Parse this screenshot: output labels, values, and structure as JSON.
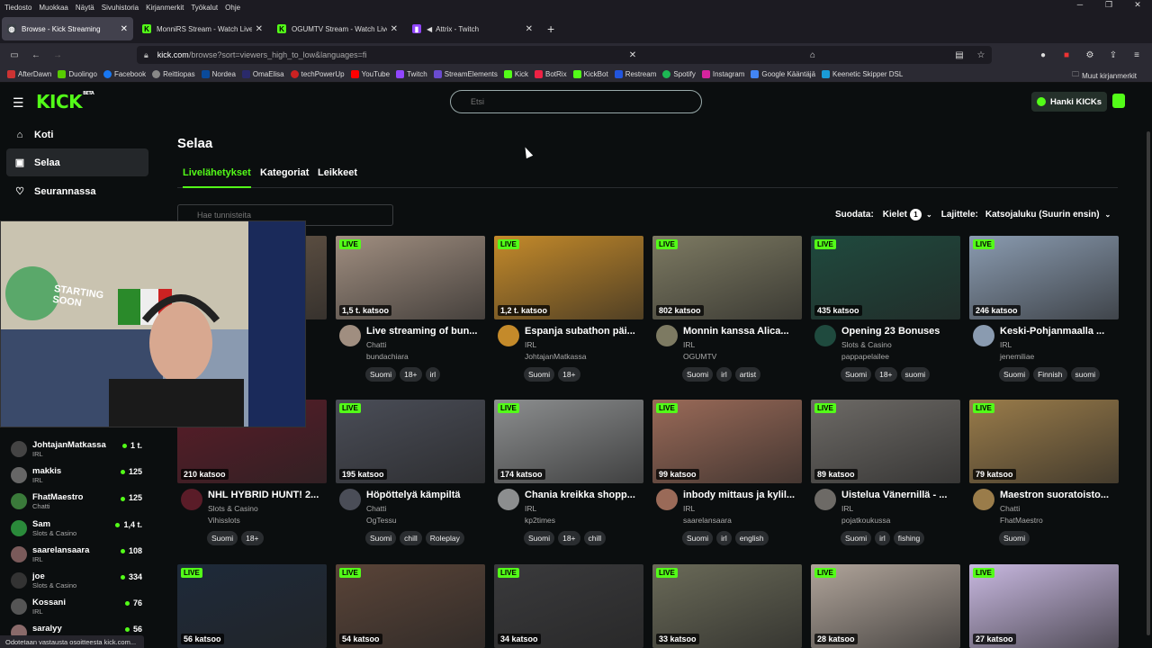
{
  "menubar": {
    "items": [
      "Tiedosto",
      "Muokkaa",
      "Näytä",
      "Sivuhistoria",
      "Kirjanmerkit",
      "Työkalut",
      "Ohje"
    ]
  },
  "tabs": [
    {
      "label": "Browse - Kick Streaming",
      "color": "#53fc18"
    },
    {
      "label": "MonniRS Stream - Watch Live o",
      "color": "#53fc18"
    },
    {
      "label": "OGUMTV Stream - Watch Live o",
      "color": "#53fc18"
    },
    {
      "label": "Attrix - Twitch",
      "color": "#9146ff"
    }
  ],
  "address": {
    "host": "kick.com",
    "path": "/browse?sort=viewers_high_to_low&languages=fi"
  },
  "bookmarks": [
    "AfterDawn",
    "Duolingo",
    "Facebook",
    "Reittiopas",
    "Nordea",
    "OmaElisa",
    "techPowerUp",
    "YouTube",
    "Twitch",
    "StreamElements",
    "Kick",
    "BotRix",
    "KickBot",
    "Restream",
    "Spotify",
    "Instagram",
    "Google Kääntäjä",
    "Keenetic Skipper DSL"
  ],
  "bookmarks_other": "Muut kirjanmerkit",
  "header": {
    "logo": "KICK",
    "logo_tag": "BETA",
    "search_placeholder": "Etsi",
    "get_kicks": "Hanki KICKs"
  },
  "sidebar": {
    "nav": [
      {
        "label": "Koti",
        "icon": "home-icon"
      },
      {
        "label": "Selaa",
        "icon": "browse-icon"
      },
      {
        "label": "Seurannassa",
        "icon": "heart-icon"
      }
    ],
    "following": [
      {
        "name": "JohtajanMatkassa",
        "category": "IRL",
        "viewers": "1 t."
      },
      {
        "name": "makkis",
        "category": "IRL",
        "viewers": "125"
      },
      {
        "name": "FhatMaestro",
        "category": "Chatti",
        "viewers": "125"
      },
      {
        "name": "Sam",
        "category": "Slots & Casino",
        "viewers": "1,4 t."
      },
      {
        "name": "saarelansaara",
        "category": "IRL",
        "viewers": "108"
      },
      {
        "name": "joe",
        "category": "Slots & Casino",
        "viewers": "334"
      },
      {
        "name": "Kossani",
        "category": "IRL",
        "viewers": "76"
      },
      {
        "name": "saralyy",
        "category": "",
        "viewers": "56"
      }
    ]
  },
  "page": {
    "title": "Selaa",
    "tabs": [
      "Livelähetykset",
      "Kategoriat",
      "Leikkeet"
    ],
    "tag_filter_placeholder": "Hae tunnisteita",
    "filter_label": "Suodata:",
    "languages_label": "Kielet",
    "languages_count": "1",
    "sort_label": "Lajittele:",
    "sort_value": "Katsojaluku (Suurin ensin)",
    "live_badge": "LIVE"
  },
  "streams": [
    {
      "viewers": "",
      "title": "",
      "category": "",
      "user": "",
      "tags": [],
      "thumb": "#6b5a4a"
    },
    {
      "viewers": "1,5 t. katsoo",
      "title": "Live streaming of bun...",
      "category": "Chatti",
      "user": "bundachiara",
      "tags": [
        "Suomi",
        "18+",
        "irl"
      ],
      "thumb": "#a08e80"
    },
    {
      "viewers": "1,2 t. katsoo",
      "title": "Espanja subathon päi...",
      "category": "IRL",
      "user": "JohtajanMatkassa",
      "tags": [
        "Suomi",
        "18+"
      ],
      "thumb": "#c48a2a"
    },
    {
      "viewers": "802 katsoo",
      "title": "Monnin kanssa Alica...",
      "category": "IRL",
      "user": "OGUMTV",
      "tags": [
        "Suomi",
        "irl",
        "artist"
      ],
      "thumb": "#7d7a62"
    },
    {
      "viewers": "435 katsoo",
      "title": "Opening 23 Bonuses",
      "category": "Slots & Casino",
      "user": "pappapelailee",
      "tags": [
        "Suomi",
        "18+",
        "suomi"
      ],
      "thumb": "#1f4a3e"
    },
    {
      "viewers": "246 katsoo",
      "title": "Keski-Pohjanmaalla ...",
      "category": "IRL",
      "user": "jenemiliae",
      "tags": [
        "Suomi",
        "Finnish",
        "suomi"
      ],
      "thumb": "#8a9bb0"
    },
    {
      "viewers": "210 katsoo",
      "title": "NHL HYBRID HUNT! 2...",
      "category": "Slots & Casino",
      "user": "Vihisslots",
      "tags": [
        "Suomi",
        "18+"
      ],
      "thumb": "#5a1c28"
    },
    {
      "viewers": "195 katsoo",
      "title": "Höpöttelyä kämpiltä",
      "category": "Chatti",
      "user": "OgTessu",
      "tags": [
        "Suomi",
        "chill",
        "Roleplay"
      ],
      "thumb": "#4a4d57"
    },
    {
      "viewers": "174 katsoo",
      "title": "Chania kreikka shopp...",
      "category": "IRL",
      "user": "kp2times",
      "tags": [
        "Suomi",
        "18+",
        "chill"
      ],
      "thumb": "#8c8e8f"
    },
    {
      "viewers": "99 katsoo",
      "title": "inbody mittaus ja kylil...",
      "category": "IRL",
      "user": "saarelansaara",
      "tags": [
        "Suomi",
        "irl",
        "english"
      ],
      "thumb": "#9a6a58"
    },
    {
      "viewers": "89 katsoo",
      "title": "Uistelua Vänernillä - ...",
      "category": "IRL",
      "user": "pojatkoukussa",
      "tags": [
        "Suomi",
        "irl",
        "fishing"
      ],
      "thumb": "#6d6a66"
    },
    {
      "viewers": "79 katsoo",
      "title": "Maestron suoratoisto...",
      "category": "Chatti",
      "user": "FhatMaestro",
      "tags": [
        "Suomi"
      ],
      "thumb": "#9a7c4a"
    },
    {
      "viewers": "56 katsoo",
      "title": "",
      "category": "",
      "user": "",
      "tags": [],
      "thumb": "#1e2a3a"
    },
    {
      "viewers": "54 katsoo",
      "title": "",
      "category": "",
      "user": "",
      "tags": [],
      "thumb": "#5a4438"
    },
    {
      "viewers": "34 katsoo",
      "title": "",
      "category": "",
      "user": "",
      "tags": [],
      "thumb": "#3a3a3c"
    },
    {
      "viewers": "33 katsoo",
      "title": "",
      "category": "",
      "user": "",
      "tags": [],
      "thumb": "#6a6a58"
    },
    {
      "viewers": "28 katsoo",
      "title": "",
      "category": "",
      "user": "",
      "tags": [],
      "thumb": "#b0a49a"
    },
    {
      "viewers": "27 katsoo",
      "title": "",
      "category": "",
      "user": "",
      "tags": [],
      "thumb": "#c8b8e0"
    }
  ],
  "webcam_overlay_text": "STARTING SOON",
  "statusbar": "Odotetaan vastausta osoitteesta kick.com...",
  "colors": {
    "accent": "#53fc18",
    "bg": "#0b0e0f"
  }
}
